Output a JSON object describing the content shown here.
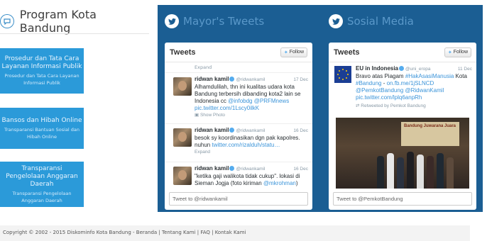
{
  "program": {
    "title": "Program Kota Bandung",
    "boxes": [
      {
        "title": "Prosedur dan Tata Cara Layanan Informasi Publik",
        "subtitle": "Prosedur dan Tata Cara Layanan Informasi Publik"
      },
      {
        "title": "Bansos dan Hibah Online",
        "subtitle": "Transparansi Bantuan Sosial dan Hibah Online"
      },
      {
        "title": "Transparansi Pengelolaan Anggaran Daerah",
        "subtitle": "Transparansi Pengelolaan Anggaran Daerah"
      }
    ]
  },
  "mayor": {
    "title": "Mayor's Tweets",
    "widget_title": "Tweets",
    "follow_label": "Follow",
    "expand_top": "Expand",
    "tweets": [
      {
        "name": "ridwan kamil",
        "handle": "@ridwankamil",
        "date": "17 Dec",
        "text": "Alhamdulilah, thn ini kualitas udara kota Bandung terbersih dibanding kota2 lain se Indonesia cc ",
        "link": "@infobdg @PRFMnews pic.twitter.com/1Lscy0ilkK",
        "meta": "Show Photo"
      },
      {
        "name": "ridwan kamil",
        "handle": "@ridwankamil",
        "date": "16 Dec",
        "text": "besok sy koordinasikan dgn pak kapolres. nuhun ",
        "link": "twitter.com/rizalduh/statu…",
        "meta": "Expand"
      },
      {
        "name": "ridwan kamil",
        "handle": "@ridwankamil",
        "date": "16 Dec",
        "text": "\"ketika gaji walikota tidak cukup\". lokasi di Sieman Jogja (foto kiriman ",
        "link": "@mkrohman",
        "meta": ")"
      }
    ],
    "input_placeholder": "Tweet to @ridwankamil"
  },
  "sosial": {
    "title": "Sosial Media",
    "widget_title": "Tweets",
    "follow_label": "Follow",
    "tweet": {
      "name": "EU in Indonesia",
      "handle": "@uni_eropa",
      "date": "11 Dec",
      "text_1": "Bravo atas Piagam ",
      "hashtag_1": "#HakAsasiManusia",
      "text_2": " Kota ",
      "hashtag_2": "#Bandung",
      "text_3": " - ",
      "link": "on.fb.me/1jSLNCD @PemkotBandung @RidwanKamil pic.twitter.com/lplq6anpRh",
      "retweet": "Retweeted by Pemkot Bandung"
    },
    "photo_banner": "Bandung Juwarana Juara",
    "input_placeholder": "Tweet to @PemkotBandung"
  },
  "footer": {
    "text": "Copyright © 2002 - 2015 Diskominfo Kota Bandung - Beranda | Tentang Kami | FAQ | Kontak Kami"
  }
}
